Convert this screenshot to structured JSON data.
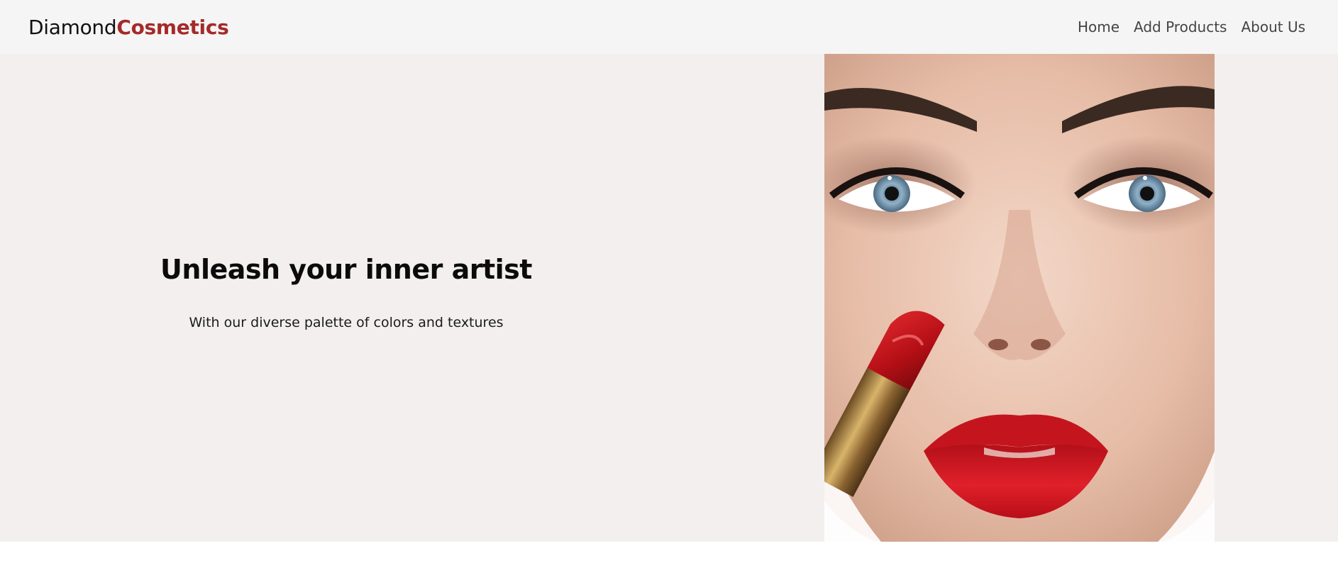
{
  "navbar": {
    "brand_main": "Diamond",
    "brand_accent": "Cosmetics",
    "links": [
      {
        "label": "Home"
      },
      {
        "label": "Add Products"
      },
      {
        "label": "About Us"
      }
    ]
  },
  "hero": {
    "title": "Unleash your inner artist",
    "subtitle": "With our diverse palette of colors and textures",
    "image": "model-face-with-red-lipstick"
  },
  "colors": {
    "brand_accent": "#a52a2a",
    "navbar_bg": "#f5f5f5",
    "hero_bg": "#f3efef",
    "lipstick_red": "#c8121c"
  }
}
